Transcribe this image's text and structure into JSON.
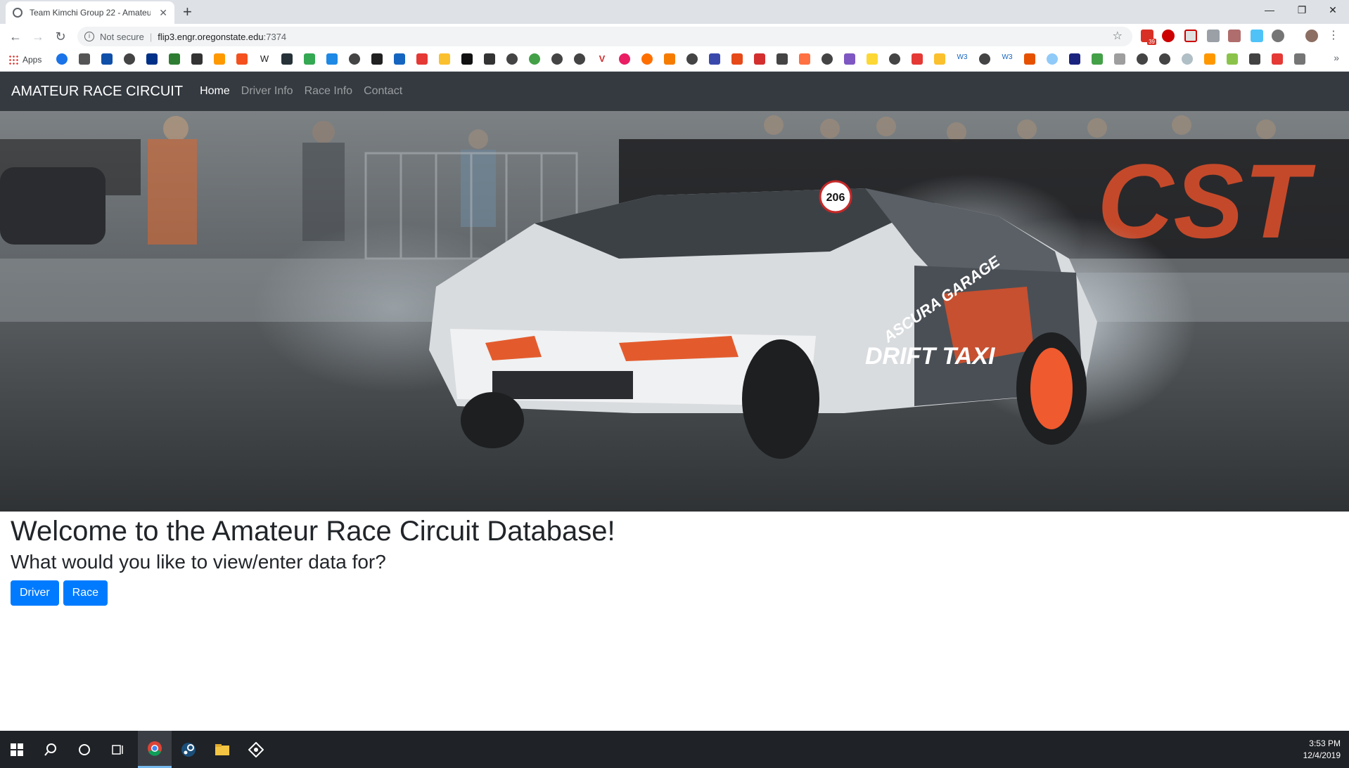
{
  "browser": {
    "tab_title": "Team Kimchi Group 22 - Amateu",
    "new_tab": "+",
    "security_label": "Not secure",
    "url_host": "flip3.engr.oregonstate.edu",
    "url_port": ":7374",
    "apps_label": "Apps",
    "gmail_badge": "39"
  },
  "site": {
    "brand": "AMATEUR RACE CIRCUIT",
    "nav": [
      "Home",
      "Driver Info",
      "Race Info",
      "Contact"
    ],
    "active_nav": "Home",
    "hero_texts": {
      "car_number": "206",
      "side_text": "DRIFT TAXI",
      "sponsor": "CST",
      "door_text": "ASCURA GARAGE"
    },
    "heading": "Welcome to the Amateur Race Circuit Database!",
    "subheading": "What would you like to view/enter data for?",
    "buttons": [
      "Driver",
      "Race"
    ]
  },
  "taskbar": {
    "time": "3:53 PM",
    "date": "12/4/2019"
  },
  "colors": {
    "navbar_bg": "#343a40",
    "primary": "#007bff",
    "taskbar_bg": "#1f2226"
  }
}
